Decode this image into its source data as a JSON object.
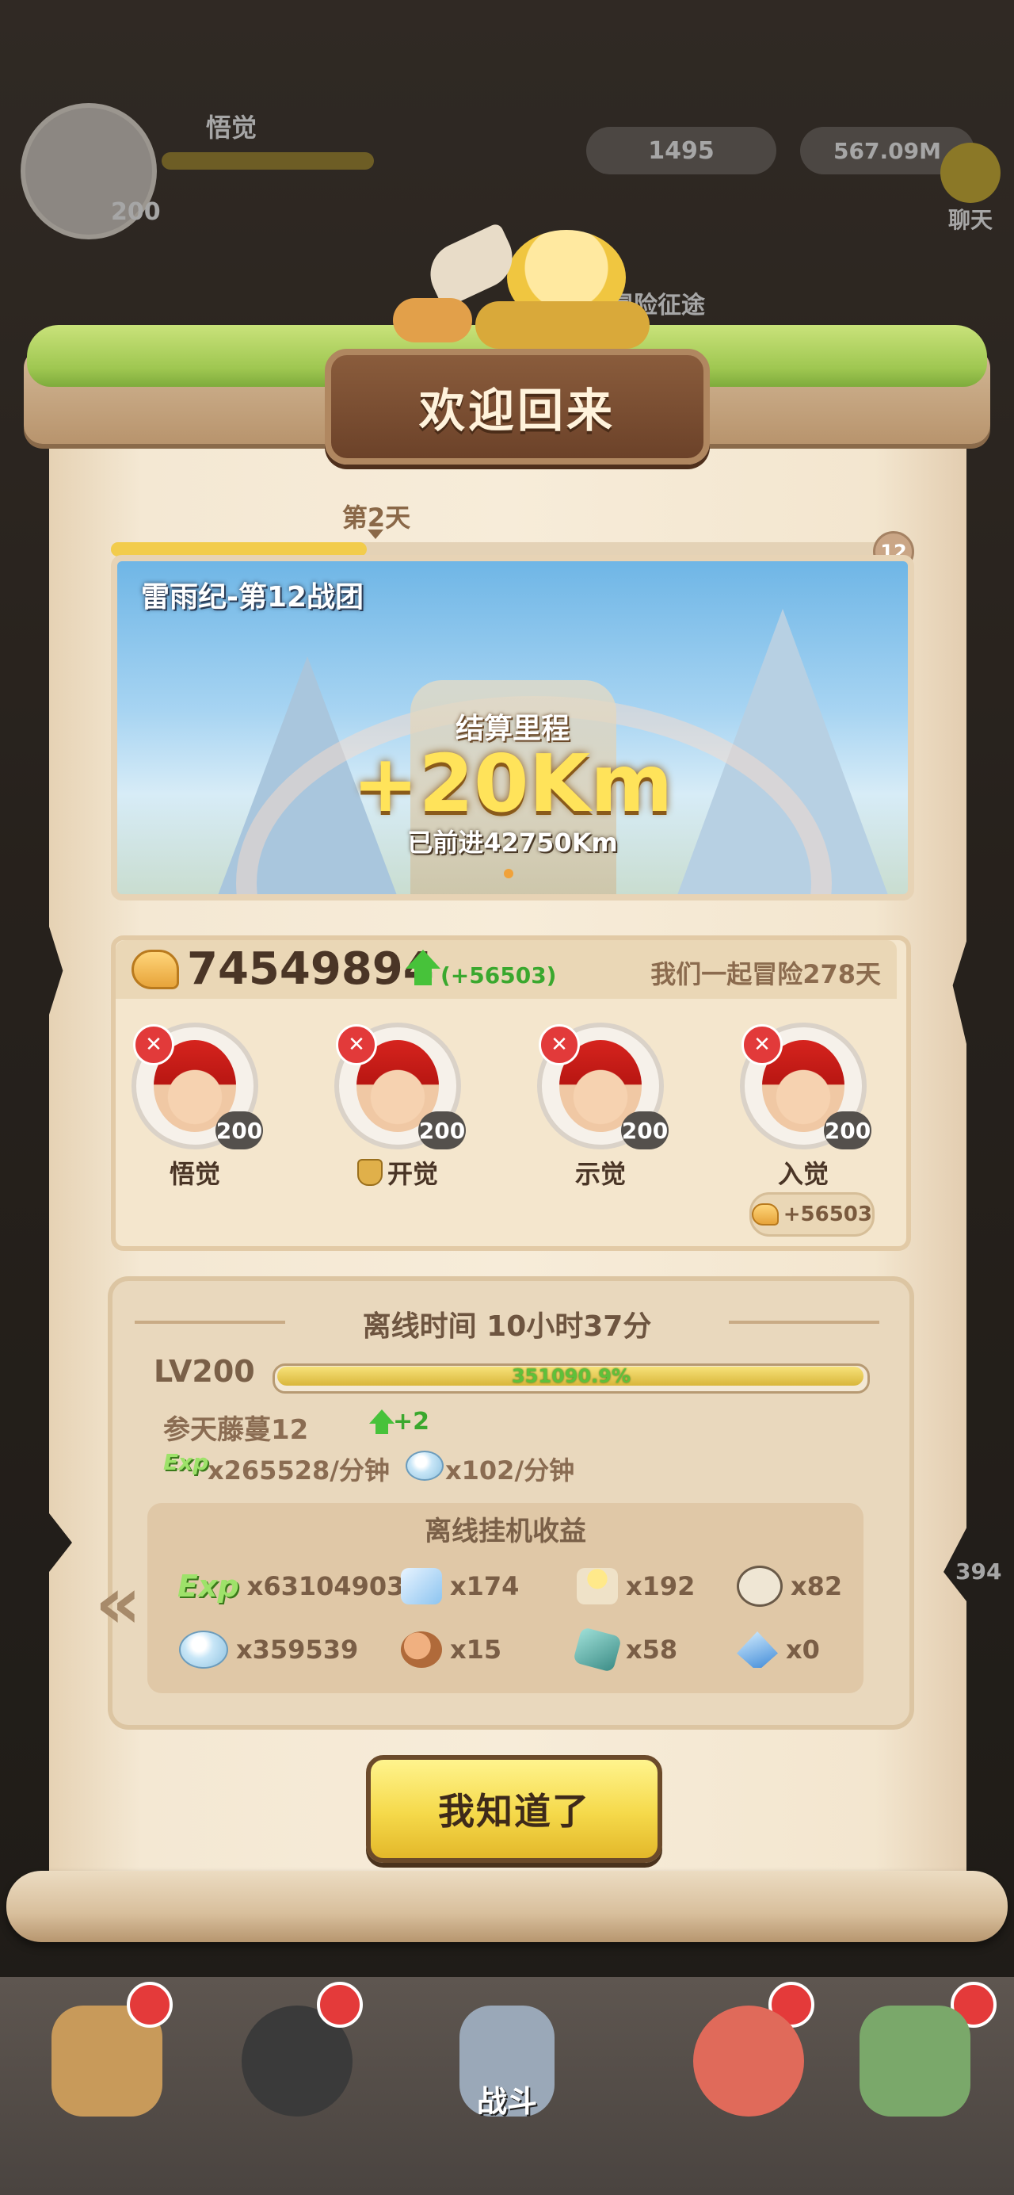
{
  "background": {
    "player_name": "悟觉",
    "player_level": "200",
    "gold": "1495",
    "diamonds": "567.09M",
    "chat_label": "聊天",
    "adventure_label": "冒险征途",
    "side_number": "394"
  },
  "dialog": {
    "title": "欢迎回来",
    "day_label": "第2天",
    "day_progress": 0.33,
    "day_badge": "12",
    "banner": {
      "title": "雷雨纪-第12战团",
      "settle_label": "结算里程",
      "settle_value": "+20Km",
      "total_distance": "已前进42750Km"
    },
    "power": {
      "value": "74549894",
      "delta": "(+56503)",
      "days_together": "我们一起冒险278天",
      "bonus": "+56503"
    },
    "heroes": [
      {
        "name": "悟觉",
        "level": "200",
        "badge": false
      },
      {
        "name": "开觉",
        "level": "200",
        "badge": true
      },
      {
        "name": "示觉",
        "level": "200",
        "badge": false
      },
      {
        "name": "入觉",
        "level": "200",
        "badge": false
      }
    ],
    "offline": {
      "title": "离线时间 10小时37分",
      "level": "LV200",
      "exp_percent_text": "351090.9%",
      "stage": "参天藤蔓12",
      "stage_delta": "+2",
      "exp_badge": "Exp",
      "exp_rate": "x265528/分钟",
      "diamond_rate": "x102/分钟",
      "earnings_title": "离线挂机收益",
      "earnings": [
        {
          "icon": "exp-icon",
          "label": "Exp",
          "amount": "x631049035"
        },
        {
          "icon": "ice-cube-icon",
          "amount": "x174"
        },
        {
          "icon": "flame-candle-icon",
          "amount": "x192"
        },
        {
          "icon": "stone-plate-icon",
          "amount": "x82"
        },
        {
          "icon": "diamond-icon",
          "amount": "x359539"
        },
        {
          "icon": "meat-icon",
          "amount": "x15"
        },
        {
          "icon": "teal-stone-icon",
          "amount": "x58"
        },
        {
          "icon": "crystal-icon",
          "amount": "x0"
        }
      ]
    },
    "confirm_button": "我知道了"
  },
  "nav": {
    "battle_label": "战斗"
  }
}
